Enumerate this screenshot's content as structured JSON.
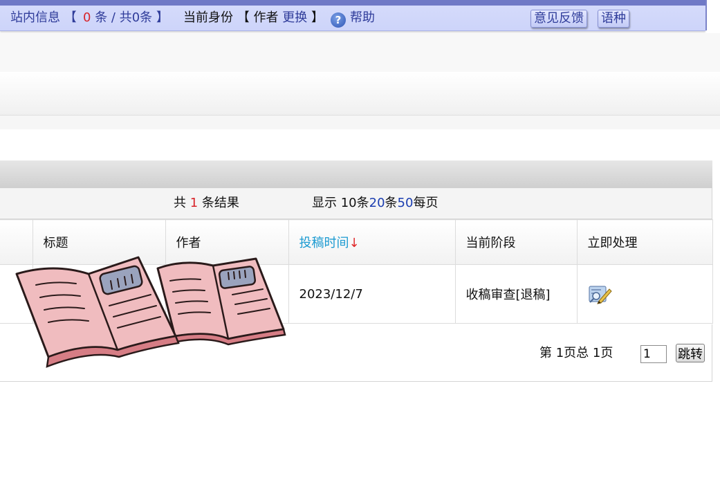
{
  "topbar": {
    "messages_label": "站内信息",
    "bracket_open": "【",
    "unread_count": "0",
    "unread_unit": "条",
    "separator": "/",
    "total_label": "共0条",
    "bracket_close": "】",
    "identity_label": "当前身份",
    "identity_value": "作者",
    "switch_link": "更换",
    "help_icon_glyph": "?",
    "help_label": "帮助",
    "feedback_button": "意见反馈",
    "language_button": "语种"
  },
  "summary": {
    "total_prefix": "共",
    "total_count": "1",
    "total_suffix": "条结果",
    "display_prefix": "显示",
    "size_10": "10",
    "unit_1": "条",
    "size_20": "20",
    "unit_2": "条",
    "size_50": "50",
    "per_page": "每页"
  },
  "table": {
    "headers": {
      "title": "标题",
      "author": "作者",
      "submit_time": "投稿时间",
      "sort_arrow": "↓",
      "stage": "当前阶段",
      "action": "立即处理"
    },
    "rows": [
      {
        "title": "",
        "author": "",
        "submit_time": "2023/12/7",
        "stage": "收稿审查[退稿]",
        "action_icon": "edit-review-icon"
      }
    ]
  },
  "pager": {
    "page_text": "第 1页总 1页",
    "page_input_value": "1",
    "jump_button": "跳转"
  },
  "colors": {
    "topbar_bg": "#cdd4fa",
    "link_blue": "#2f3c9a",
    "count_red": "#d8242a",
    "sort_link": "#1b9ad1"
  }
}
